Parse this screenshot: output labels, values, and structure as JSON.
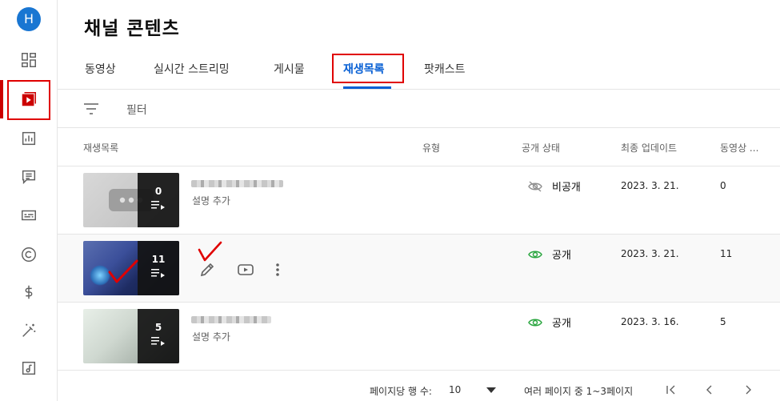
{
  "user": {
    "avatar_letter": "H",
    "avatar_color": "#1976d2"
  },
  "page": {
    "title": "채널 콘텐츠"
  },
  "tabs": [
    {
      "label": "동영상"
    },
    {
      "label": "실시간 스트리밍"
    },
    {
      "label": "게시물"
    },
    {
      "label": "재생목록",
      "active": true
    },
    {
      "label": "팟캐스트"
    }
  ],
  "filter": {
    "label": "필터"
  },
  "columns": {
    "playlist": "재생목록",
    "type": "유형",
    "visibility": "공개 상태",
    "last_updated": "최종 업데이트",
    "video_count": "동영상 ..."
  },
  "rows": [
    {
      "video_count_badge": "0",
      "description": "설명 추가",
      "type": "",
      "visibility": "비공개",
      "visibility_icon": "eye-off-icon",
      "last_updated": "2023. 3. 21.",
      "video_count": "0"
    },
    {
      "video_count_badge": "11",
      "description": "",
      "type": "",
      "visibility": "공개",
      "visibility_icon": "eye-icon",
      "last_updated": "2023. 3. 21.",
      "video_count": "11"
    },
    {
      "video_count_badge": "5",
      "description": "설명 추가",
      "type": "",
      "visibility": "공개",
      "visibility_icon": "eye-icon",
      "last_updated": "2023. 3. 16.",
      "video_count": "5"
    }
  ],
  "pagination": {
    "rows_per_page_label": "페이지당 행 수:",
    "rows_per_page_value": "10",
    "range_label": "여러 페이지 중 1~3페이지"
  },
  "colors": {
    "accent": "#065fd4",
    "brand": "#cc0000",
    "annotation": "#e00000",
    "public_green": "#2ba640"
  }
}
